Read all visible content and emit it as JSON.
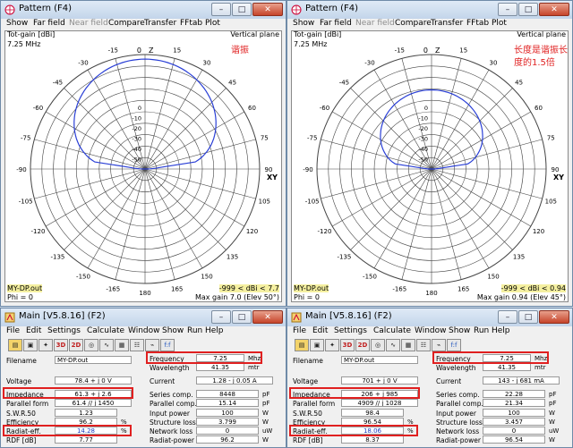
{
  "pattern_windows": [
    {
      "title": "Pattern   (F4)",
      "menu": [
        "Show",
        "Far field",
        "Near field",
        "Compare",
        "Transfer",
        "FFtab",
        "Plot"
      ],
      "label_left": "Tot-gain [dBi]",
      "label_right": "Vertical plane",
      "freq": "7.25 MHz",
      "annotation": "谐振",
      "bottom_left_file": "MY-DP.out",
      "bottom_left_phi": "Phi = 0",
      "bottom_right_range": "-999 < dBi < 7.7",
      "bottom_right_max": "Max gain 7.0 (Elev 50°)",
      "elevation_labels": {
        "top": "0",
        "left": "-90",
        "right": "90",
        "z": "Z",
        "xy": "XY"
      },
      "pattern_tilt": 0,
      "pattern_gain": 1.0
    },
    {
      "title": "Pattern   (F4)",
      "menu": [
        "Show",
        "Far field",
        "Near field",
        "Compare",
        "Transfer",
        "FFtab",
        "Plot"
      ],
      "label_left": "Tot-gain [dBi]",
      "label_right": "Vertical plane",
      "freq": "7.25 MHz",
      "annotation_line1": "长度是谐振长",
      "annotation_line2": "度的1.5倍",
      "bottom_left_file": "MY-DP.out",
      "bottom_left_phi": "Phi = 0",
      "bottom_right_range": "-999 < dBi < 0.94",
      "bottom_right_max": "Max gain 0.94 (Elev 45°)",
      "elevation_labels": {
        "top": "0",
        "left": "-90",
        "right": "90",
        "z": "Z",
        "xy": "XY"
      },
      "pattern_tilt": 0,
      "pattern_gain": 0.72
    }
  ],
  "polar_ticks": [
    "-15",
    "-30",
    "-45",
    "-60",
    "-75",
    "-90",
    "-105",
    "-120",
    "-135",
    "-150",
    "-165",
    "180",
    "165",
    "150",
    "135",
    "120",
    "105",
    "90",
    "75",
    "60",
    "45",
    "30",
    "15"
  ],
  "radial_labels": [
    "-50",
    "-40",
    "-30",
    "-20",
    "-10",
    "0"
  ],
  "main_windows": [
    {
      "title": "Main [V5.8.16]   (F2)",
      "menu": [
        "File",
        "Edit",
        "Settings",
        "Calculate",
        "Window",
        "Show",
        "Run",
        "Help"
      ],
      "filename_label": "Filename",
      "filename": "MY-DP.out",
      "frequency_label": "Frequency",
      "frequency": "7.25",
      "frequency_unit": "Mhz",
      "wavelength_label": "Wavelength",
      "wavelength": "41.35",
      "wavelength_unit": "mtr",
      "voltage_label": "Voltage",
      "voltage": "78.4 + j 0 V",
      "current_label": "Current",
      "current": "1.28 - j 0.05 A",
      "impedance_label": "Impedance",
      "impedance": "61.3 + j 2.6",
      "parallel_label": "Parallel form",
      "parallel": "61.4 // j 1450",
      "swr_label": "S.W.R.50",
      "swr": "1.23",
      "efficiency_label": "Efficiency",
      "efficiency": "96.2",
      "efficiency_unit": "%",
      "radiat_label": "Radiat-eff.",
      "radiat": "14.28",
      "radiat_unit": "%",
      "rdf_label": "RDF [dB]",
      "rdf": "7.77",
      "series_label": "Series comp.",
      "series": "8448",
      "series_unit": "pF",
      "parcomp_label": "Parallel comp.",
      "parcomp": "15.14",
      "parcomp_unit": "pF",
      "input_label": "Input power",
      "input": "100",
      "input_unit": "W",
      "structure_label": "Structure loss",
      "structure": "3.799",
      "structure_unit": "W",
      "network_label": "Network loss",
      "network": "0",
      "network_unit": "uW",
      "radpower_label": "Radiat-power",
      "radpower": "96.2",
      "radpower_unit": "W"
    },
    {
      "title": "Main [V5.8.16]   (F2)",
      "menu": [
        "File",
        "Edit",
        "Settings",
        "Calculate",
        "Window",
        "Show",
        "Run",
        "Help"
      ],
      "filename_label": "Filename",
      "filename": "MY-DP.out",
      "frequency_label": "Frequency",
      "frequency": "7.25",
      "frequency_unit": "Mhz",
      "wavelength_label": "Wavelength",
      "wavelength": "41.35",
      "wavelength_unit": "mtr",
      "voltage_label": "Voltage",
      "voltage": "701 + j 0 V",
      "current_label": "Current",
      "current": "143 - j 681 mA",
      "impedance_label": "Impedance",
      "impedance": "206 + j 985",
      "parallel_label": "Parallel form",
      "parallel": "4909 // j 1028",
      "swr_label": "S.W.R.50",
      "swr": "98.4",
      "efficiency_label": "Efficiency",
      "efficiency": "96.54",
      "efficiency_unit": "%",
      "radiat_label": "Radiat-eff.",
      "radiat": "18.06",
      "radiat_unit": "%",
      "rdf_label": "RDF [dB]",
      "rdf": "8.37",
      "series_label": "Series comp.",
      "series": "22.28",
      "series_unit": "pF",
      "parcomp_label": "Parallel comp.",
      "parcomp": "21.34",
      "parcomp_unit": "pF",
      "input_label": "Input power",
      "input": "100",
      "input_unit": "W",
      "structure_label": "Structure loss",
      "structure": "3.457",
      "structure_unit": "W",
      "network_label": "Network loss",
      "network": "0",
      "network_unit": "uW",
      "radpower_label": "Radiat-power",
      "radpower": "96.54",
      "radpower_unit": "W"
    }
  ],
  "colors": {
    "pattern": "#2a3fd6",
    "annotation": "#e02020",
    "red_box": "#e02020",
    "field_blue": "#1f40c0"
  }
}
